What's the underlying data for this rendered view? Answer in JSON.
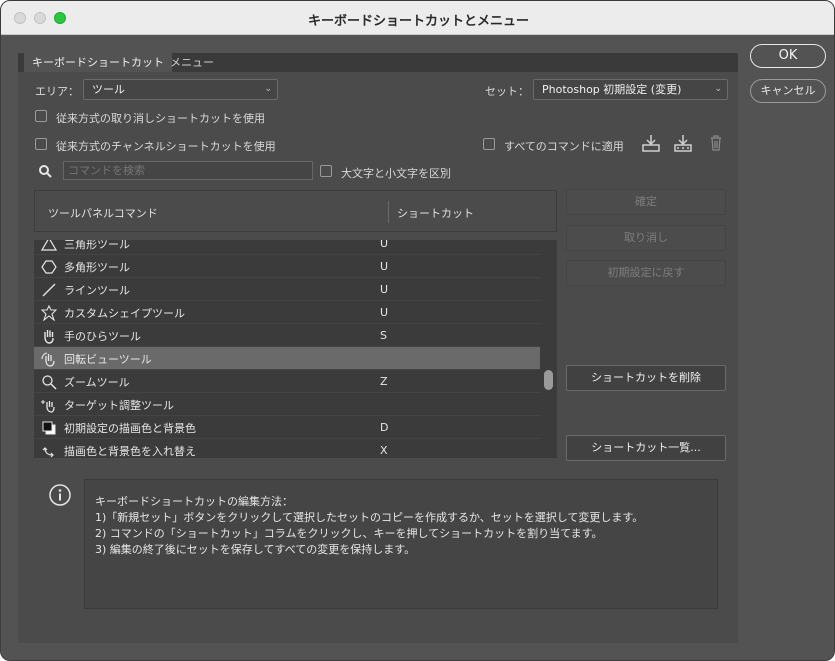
{
  "window": {
    "title": "キーボードショートカットとメニュー"
  },
  "tabs": [
    {
      "label": "キーボードショートカット"
    },
    {
      "label": "メニュー"
    }
  ],
  "area": {
    "label": "エリア：",
    "value": "ツール"
  },
  "set": {
    "label": "セット：",
    "value": "Photoshop 初期設定 (変更)"
  },
  "options": {
    "legacy_undo": "従来方式の取り消しショートカットを使用",
    "legacy_channel": "従来方式のチャンネルショートカットを使用",
    "apply_all": "すべてのコマンドに適用",
    "case_sensitive": "大文字と小文字を区別"
  },
  "search": {
    "placeholder": "コマンドを検索"
  },
  "table": {
    "col_command": "ツールパネルコマンド",
    "col_shortcut": "ショートカット",
    "rows": [
      {
        "name": "三角形ツール",
        "key": "U",
        "icon": "triangle-icon"
      },
      {
        "name": "多角形ツール",
        "key": "U",
        "icon": "polygon-icon"
      },
      {
        "name": "ラインツール",
        "key": "U",
        "icon": "line-icon"
      },
      {
        "name": "カスタムシェイプツール",
        "key": "U",
        "icon": "custom-shape-icon"
      },
      {
        "name": "手のひらツール",
        "key": "S",
        "icon": "hand-icon"
      },
      {
        "name": "回転ビューツール",
        "key": "",
        "icon": "rotate-view-icon"
      },
      {
        "name": "ズームツール",
        "key": "Z",
        "icon": "zoom-icon"
      },
      {
        "name": "ターゲット調整ツール",
        "key": "",
        "icon": "targeted-adjust-icon"
      },
      {
        "name": "初期設定の描画色と背景色",
        "key": "D",
        "icon": "default-colors-icon"
      },
      {
        "name": "描画色と背景色を入れ替え",
        "key": "X",
        "icon": "swap-colors-icon"
      }
    ],
    "selected_index": 5
  },
  "side_buttons": {
    "accept": "確定",
    "undo": "取り消し",
    "reset": "初期設定に戻す",
    "delete": "ショートカットを削除",
    "summarize": "ショートカット一覧..."
  },
  "info": {
    "heading": "キーボードショートカットの編集方法：",
    "step1": "1)「新規セット」ボタンをクリックして選択したセットのコピーを作成するか、セットを選択して変更します。",
    "step2": "2) コマンドの「ショートカット」コラムをクリックし、キーを押してショートカットを割り当てます。",
    "step3": "3) 編集の終了後にセットを保存してすべての変更を保持します。"
  },
  "dialog_buttons": {
    "ok": "OK",
    "cancel": "キャンセル"
  }
}
